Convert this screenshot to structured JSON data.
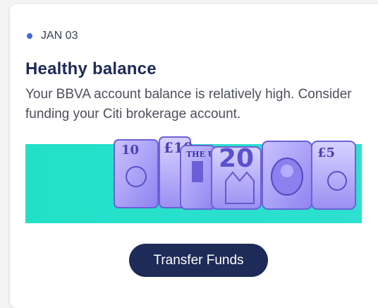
{
  "card": {
    "date": "JAN 03",
    "title": "Healthy balance",
    "body": "Your BBVA account balance is relatively high. Consider funding your Citi brokerage account.",
    "illustration_icon": "money-banknotes-icon",
    "banner_color": "#22e0c8",
    "button_label": "Transfer Funds",
    "accent_color": "#3f68d8"
  }
}
